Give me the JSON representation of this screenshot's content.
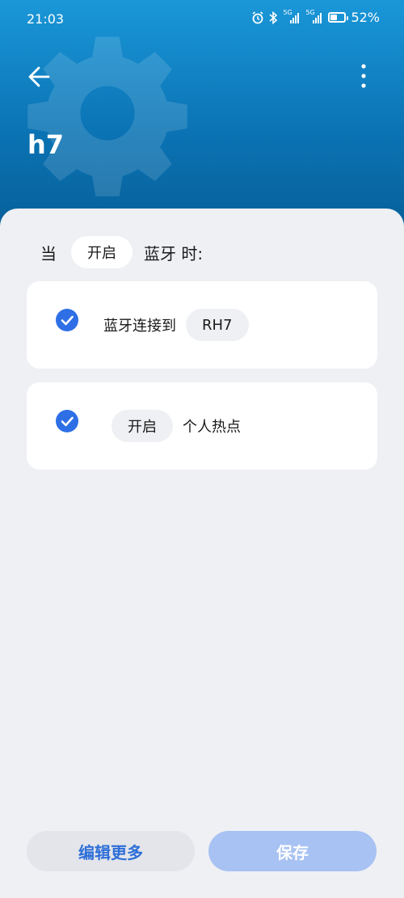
{
  "status_bar": {
    "time": "21:03",
    "network_1": "5G",
    "network_2": "5G",
    "battery_percent": "52%",
    "battery_level": 0.52
  },
  "header": {
    "title": "h7",
    "back_icon": "arrow-left-icon",
    "more_icon": "more-vertical-icon",
    "background_icon": "gear-icon",
    "gradient_top": "#1a97d8",
    "gradient_bottom": "#075f98"
  },
  "condition": {
    "prefix": "当",
    "state": "开启",
    "subject": "蓝牙 时:"
  },
  "actions": [
    {
      "checked": true,
      "label": "蓝牙连接到",
      "value": "RH7"
    },
    {
      "checked": true,
      "state": "开启",
      "label": "个人热点"
    }
  ],
  "footer": {
    "edit_more": "编辑更多",
    "save": "保存"
  },
  "colors": {
    "accent": "#2e6fe6",
    "save_button": "#a7c2f3",
    "edit_button_text": "#2f6fd8"
  }
}
